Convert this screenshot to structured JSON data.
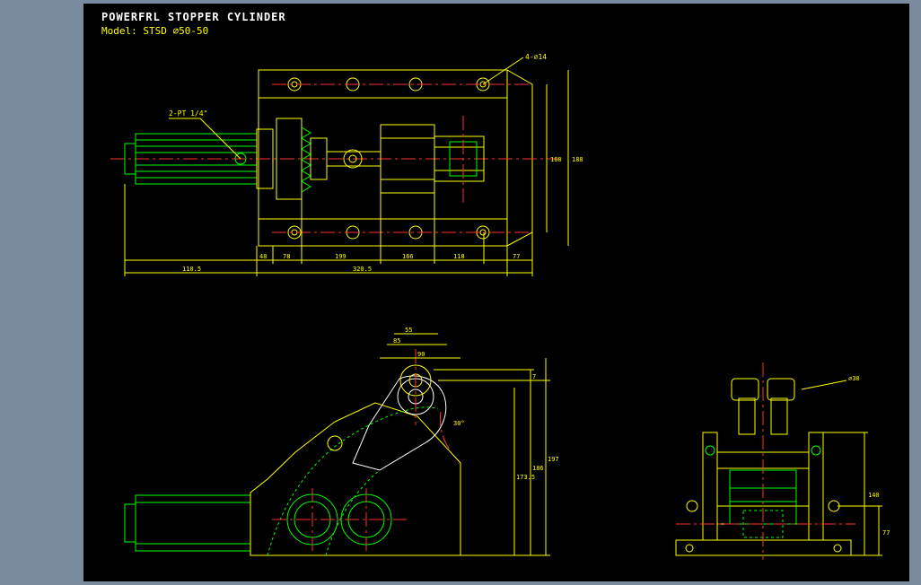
{
  "header": {
    "title": "POWERFRL STOPPER CYLINDER",
    "model_label": "Model:",
    "model_value": "STSD ⌀50-50"
  },
  "annotations": {
    "port_note": "2-PT 1/4\"",
    "hole_note": "4-⌀14"
  },
  "top_view": {
    "dims_horizontal": {
      "overall_left": "110.5",
      "seg_a": "48",
      "seg_b": "78",
      "seg_c": "199",
      "seg_d": "166",
      "seg_e": "118",
      "seg_f": "77",
      "overall": "320.5"
    },
    "dims_vertical": {
      "hole_pitch": "160",
      "overall": "188"
    }
  },
  "side_view": {
    "dims_horizontal": {
      "a": "85",
      "b": "90",
      "c": "55"
    },
    "dims_vertical": {
      "roller_center": "7",
      "angle": "30°",
      "h1": "173.5",
      "h2": "186",
      "h3": "197"
    }
  },
  "end_view": {
    "dims_vertical": {
      "roller": "⌀30",
      "h1": "140",
      "h2": "77"
    }
  }
}
